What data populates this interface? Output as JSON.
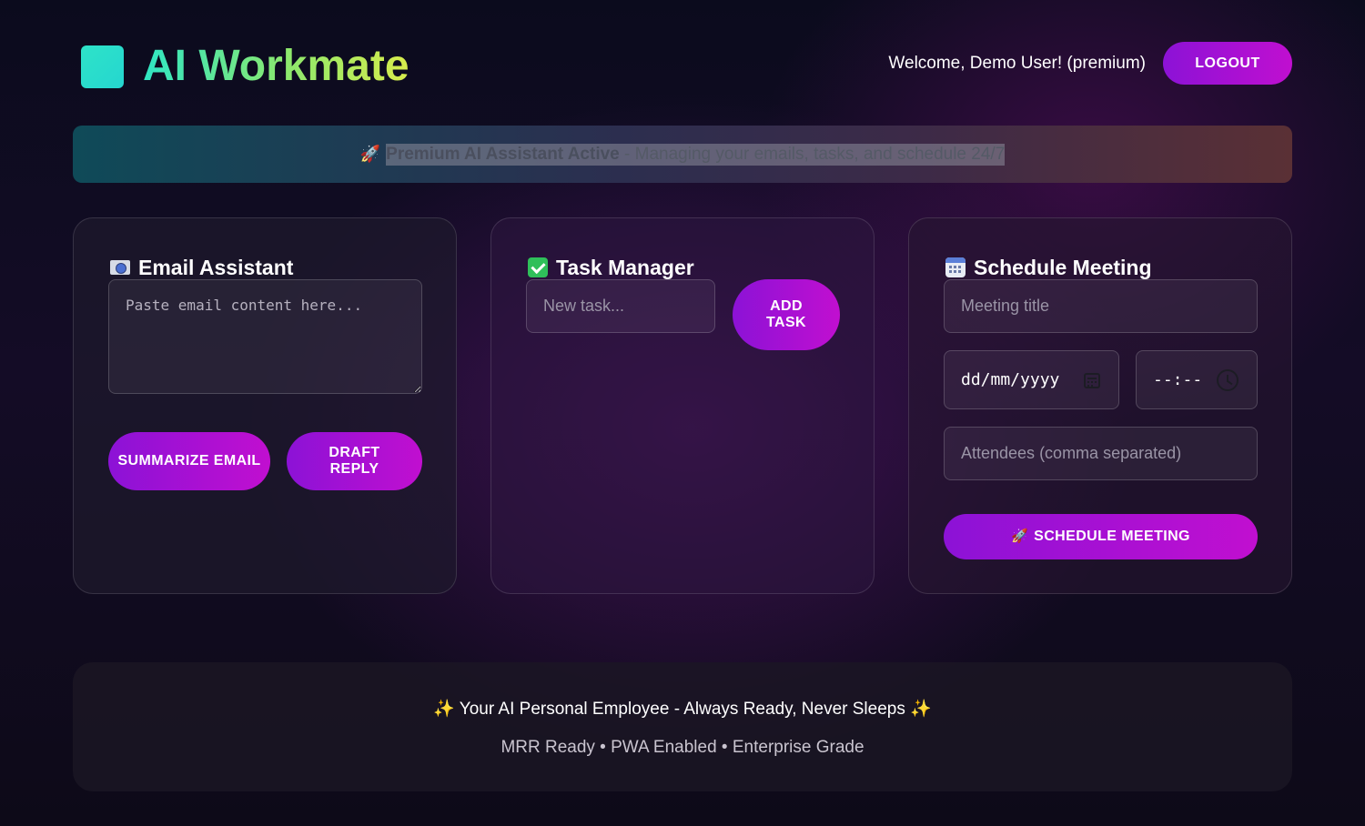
{
  "header": {
    "app_title": "AI Workmate",
    "welcome_text": "Welcome, Demo User! (premium)",
    "logout_label": "LOGOUT"
  },
  "banner": {
    "icon": "rocket-icon",
    "strong_text": "Premium AI Assistant Active",
    "rest_text": " - Managing your emails, tasks, and schedule 24/7"
  },
  "email_card": {
    "title": "Email Assistant",
    "icon": "email-icon",
    "textarea_placeholder": "Paste email content here...",
    "summarize_label": "SUMMARIZE EMAIL",
    "draft_label": "DRAFT REPLY"
  },
  "task_card": {
    "title": "Task Manager",
    "icon": "check-icon",
    "input_placeholder": "New task...",
    "add_label": "ADD TASK"
  },
  "schedule_card": {
    "title": "Schedule Meeting",
    "icon": "calendar-icon",
    "title_placeholder": "Meeting title",
    "date_placeholder": "dd/mm/yyyy",
    "time_placeholder": "--:--",
    "attendees_placeholder": "Attendees (comma separated)",
    "schedule_label": "SCHEDULE MEETING"
  },
  "footer": {
    "tagline": " Your AI Personal Employee - Always Ready, Never Sleeps ",
    "features": "MRR Ready • PWA Enabled • Enterprise Grade"
  },
  "colors": {
    "accent_gradient_start": "#8c12d6",
    "accent_gradient_end": "#c10fd0",
    "logo_teal": "#2ee3c8"
  }
}
